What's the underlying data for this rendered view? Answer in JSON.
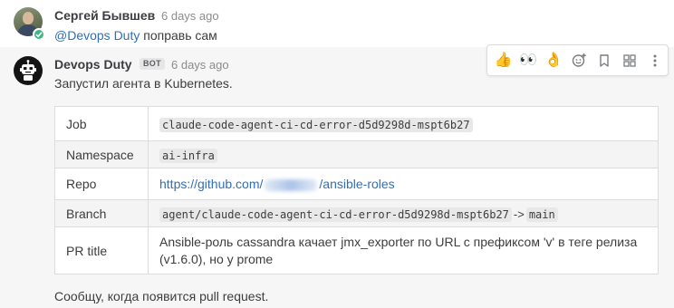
{
  "message1": {
    "author": "Сергей Бывшев",
    "time": "6 days ago",
    "mention": "@Devops Duty",
    "text": " поправь сам",
    "avatar_icon": "user-photo",
    "status_icon": "check-icon"
  },
  "message2": {
    "author": "Devops Duty",
    "badge": "BOT",
    "time": "6 days ago",
    "text": "Запустил агента в Kubernetes.",
    "footer": "Сообщу, когда появится pull request.",
    "avatar_icon": "robot-icon"
  },
  "reaction_bar": {
    "thumbs_up": "👍",
    "eyes": "👀",
    "ok_hand": "👌",
    "add_reaction_icon": "smiley-plus-icon",
    "bookmark_icon": "bookmark-icon",
    "apps_icon": "grid-icon",
    "more_icon": "ellipsis-vertical-icon"
  },
  "table": {
    "rows": [
      {
        "key": "Job",
        "value": "claude-code-agent-ci-cd-error-d5d9298d-mspt6b27"
      },
      {
        "key": "Namespace",
        "value": "ai-infra"
      },
      {
        "key": "Repo",
        "value_prefix": "https://github.com/",
        "value_suffix": "/ansible-roles"
      },
      {
        "key": "Branch",
        "value": "agent/claude-code-agent-ci-cd-error-d5d9298d-mspt6b27",
        "arrow": "->",
        "target": "main"
      },
      {
        "key": "PR title",
        "value": "Ansible-роль cassandra качает jmx_exporter по URL с префиксом 'v' в теге релиза (v1.6.0), но у prome"
      }
    ]
  },
  "colors": {
    "link": "#2f6fb9",
    "online_status": "#3db887",
    "hover_background": "#f6f6f6"
  }
}
